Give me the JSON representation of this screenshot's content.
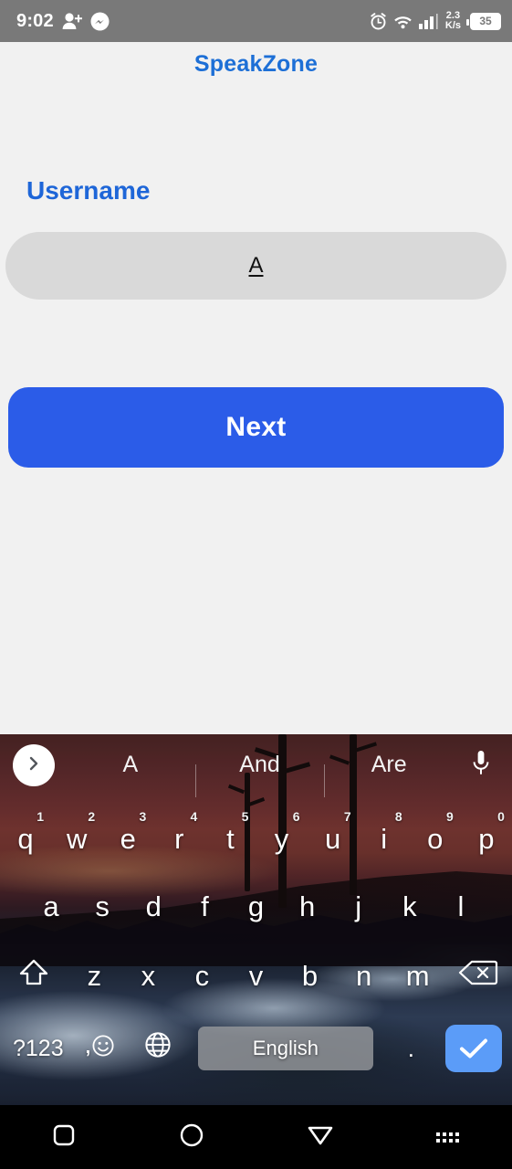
{
  "status_bar": {
    "time": "9:02",
    "left_icons": [
      "person-add-icon",
      "messenger-icon"
    ],
    "right_icons": [
      "alarm-icon",
      "wifi-icon",
      "signal-icon"
    ],
    "network_speed_value": "2.3",
    "network_speed_unit": "K/s",
    "battery_level": "35",
    "background_color": "#797979"
  },
  "app": {
    "title": "SpeakZone",
    "title_color": "#1d6fd6",
    "background_color": "#f1f1f1",
    "form": {
      "field_label": "Username",
      "field_label_color": "#1e66d8",
      "input_value": "A",
      "input_placeholder": "",
      "input_background": "#d9d9d9"
    },
    "next_button": {
      "label": "Next",
      "background_color": "#2b5ce8",
      "text_color": "#ffffff"
    }
  },
  "keyboard": {
    "theme": "sunset-landscape-photo",
    "expand_icon": "chevron-right-icon",
    "mic_icon": "microphone-icon",
    "suggestions": [
      "A",
      "And",
      "Are"
    ],
    "row1": [
      {
        "key": "q",
        "num": "1"
      },
      {
        "key": "w",
        "num": "2"
      },
      {
        "key": "e",
        "num": "3"
      },
      {
        "key": "r",
        "num": "4"
      },
      {
        "key": "t",
        "num": "5"
      },
      {
        "key": "y",
        "num": "6"
      },
      {
        "key": "u",
        "num": "7"
      },
      {
        "key": "i",
        "num": "8"
      },
      {
        "key": "o",
        "num": "9"
      },
      {
        "key": "p",
        "num": "0"
      }
    ],
    "row2": [
      "a",
      "s",
      "d",
      "f",
      "g",
      "h",
      "j",
      "k",
      "l"
    ],
    "row3": {
      "shift_icon": "shift-up-arrow-icon",
      "letters": [
        "z",
        "x",
        "c",
        "v",
        "b",
        "n",
        "m"
      ],
      "backspace_icon": "backspace-delete-icon"
    },
    "row4": {
      "symbols_label": "?123",
      "emoji_icon": "emoji-smiley-icon",
      "comma_label": ",",
      "globe_icon": "globe-language-icon",
      "space_label": "English",
      "period_label": ".",
      "enter_icon": "checkmark-enter-icon",
      "enter_background": "#5b9cf8",
      "space_background": "#96989c"
    }
  },
  "nav_bar": {
    "background_color": "#000000",
    "buttons": [
      {
        "name": "recents-button",
        "icon": "square-icon"
      },
      {
        "name": "home-button",
        "icon": "circle-icon"
      },
      {
        "name": "back-button",
        "icon": "down-triangle-icon"
      },
      {
        "name": "keyboard-switch-button",
        "icon": "keyboard-icon"
      }
    ]
  }
}
